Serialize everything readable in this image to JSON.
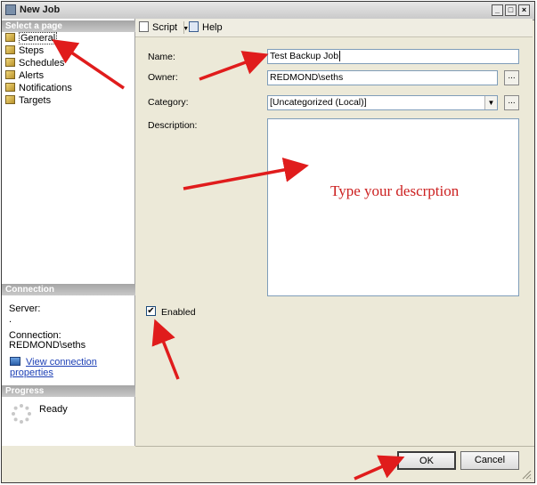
{
  "window": {
    "title": "New Job"
  },
  "sidebar": {
    "select_page_header": "Select a page",
    "pages": [
      {
        "label": "General",
        "selected": true
      },
      {
        "label": "Steps"
      },
      {
        "label": "Schedules"
      },
      {
        "label": "Alerts"
      },
      {
        "label": "Notifications"
      },
      {
        "label": "Targets"
      }
    ],
    "connection_header": "Connection",
    "server_label": "Server:",
    "server_value": ".",
    "connection_label": "Connection:",
    "connection_value": "REDMOND\\seths",
    "view_connection_link": "View connection properties",
    "progress_header": "Progress",
    "progress_status": "Ready"
  },
  "toolbar": {
    "script_label": "Script",
    "help_label": "Help"
  },
  "form": {
    "name_label": "Name:",
    "name_value": "Test Backup Job",
    "owner_label": "Owner:",
    "owner_value": "REDMOND\\seths",
    "category_label": "Category:",
    "category_value": "[Uncategorized (Local)]",
    "description_label": "Description:",
    "enabled_label": "Enabled",
    "enabled_checked": true,
    "browse_label": "..."
  },
  "annotation": {
    "text": "Type your descrption",
    "color": "#cc1f1f"
  },
  "buttons": {
    "ok_label": "OK",
    "cancel_label": "Cancel"
  }
}
